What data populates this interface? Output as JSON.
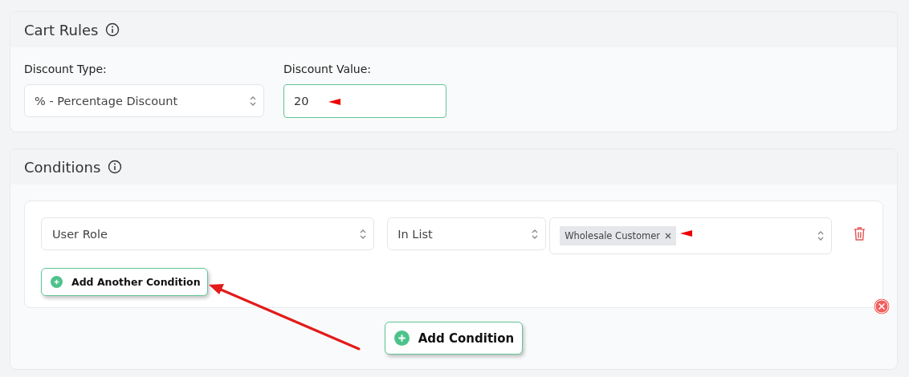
{
  "cart_rules": {
    "title": "Cart Rules",
    "discount_type": {
      "label": "Discount Type:",
      "value": "% - Percentage Discount"
    },
    "discount_value": {
      "label": "Discount Value:",
      "value": "20"
    }
  },
  "conditions": {
    "title": "Conditions",
    "rows": [
      {
        "field": "User Role",
        "operator": "In List",
        "values": [
          "Wholesale Customer"
        ]
      }
    ],
    "add_another_button": "Add Another Condition",
    "add_button": "Add Condition"
  }
}
